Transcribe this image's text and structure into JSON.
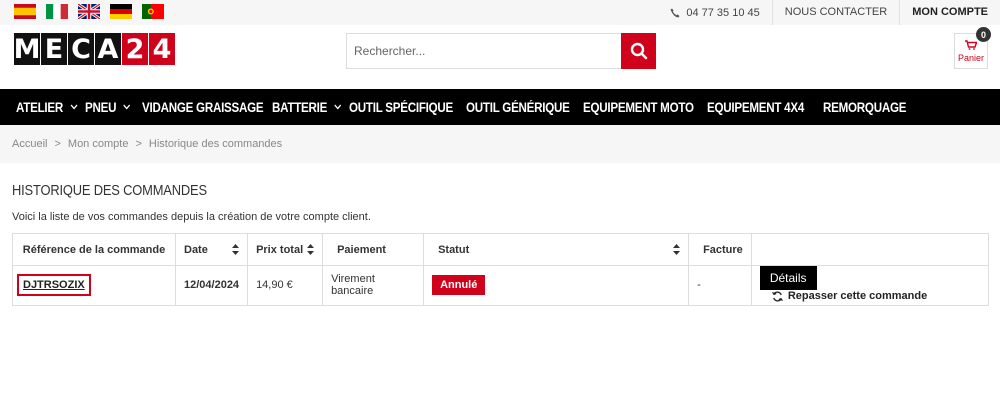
{
  "topbar": {
    "flags": [
      "spain-flag-icon",
      "italy-flag-icon",
      "uk-flag-icon",
      "germany-flag-icon",
      "portugal-flag-icon"
    ],
    "phone": "04 77 35 10 45",
    "contact": "NOUS CONTACTER",
    "account": "MON COMPTE"
  },
  "header": {
    "logo_black": [
      "M",
      "E",
      "C",
      "A"
    ],
    "logo_red": [
      "2",
      "4"
    ],
    "search_placeholder": "Rechercher...",
    "cart_label": "Panier",
    "cart_count": "0"
  },
  "nav": {
    "items": [
      "ATELIER",
      "PNEU",
      "VIDANGE GRAISSAGE",
      "BATTERIE",
      "OUTIL SPÉCIFIQUE",
      "OUTIL GÉNÉRIQUE",
      "EQUIPEMENT MOTO",
      "EQUIPEMENT 4X4",
      "REMORQUAGE"
    ]
  },
  "breadcrumb": [
    "Accueil",
    "Mon compte",
    "Historique des commandes"
  ],
  "page": {
    "title": "HISTORIQUE DES COMMANDES",
    "intro": "Voici la liste de vos commandes depuis la création de votre compte client."
  },
  "table": {
    "headers": [
      "Référence de la commande",
      "Date",
      "Prix total",
      "Paiement",
      "Statut",
      "Facture",
      ""
    ],
    "rows": [
      {
        "reference": "DJTRSOZIX",
        "date": "12/04/2024",
        "total": "14,90 €",
        "payment": "Virement bancaire",
        "status": "Annulé",
        "invoice": "-",
        "details": "Détails",
        "reorder": "Repasser cette commande"
      }
    ]
  },
  "colors": {
    "accent": "#d0021b",
    "nav_bg": "#000000"
  }
}
